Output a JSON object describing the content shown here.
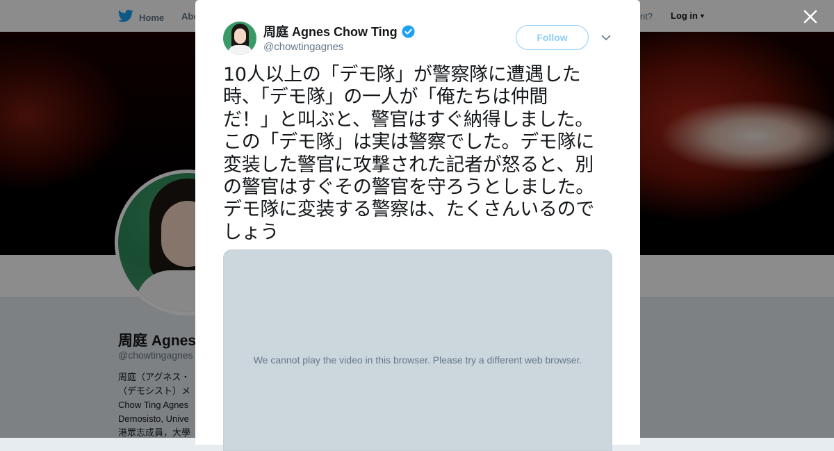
{
  "nav": {
    "home_label": "Home",
    "about_label": "Abo",
    "account_prompt": "count?",
    "login_label": "Log in"
  },
  "profile": {
    "name": "周庭 Agnes",
    "handle": "@chowtingagnes",
    "bio_lines": [
      "周庭（アグネス・",
      "（デモシスト）メ",
      "Chow Ting Agnes",
      "Demosisto, Unive",
      "港眾志成員，大學"
    ]
  },
  "tweet": {
    "author_name": "周庭 Agnes Chow Ting",
    "author_handle": "@chowtingagnes",
    "verified": true,
    "follow_label": "Follow",
    "text": "10人以上の「デモ隊」が警察隊に遭遇した\n時、「デモ隊」の一人が「俺たちは仲間\nだ！」と叫ぶと、警官はすぐ納得しました。\nこの「デモ隊」は実は警察でした。デモ隊に\n変装した警官に攻撃された記者が怒ると、別\nの警官はすぐその警官を守ろうとしました。\nデモ隊に変装する警察は、たくさんいるので\nしょう",
    "video_message": "We cannot play the video in this browser. Please try a different web browser."
  },
  "colors": {
    "accent": "#1da1f2",
    "text": "#14171a",
    "muted": "#657786",
    "video_bg": "#ccd6dd"
  },
  "icons": [
    "twitter-bird-icon",
    "caret-down-icon",
    "close-icon",
    "verified-badge-icon",
    "chevron-down-icon"
  ]
}
